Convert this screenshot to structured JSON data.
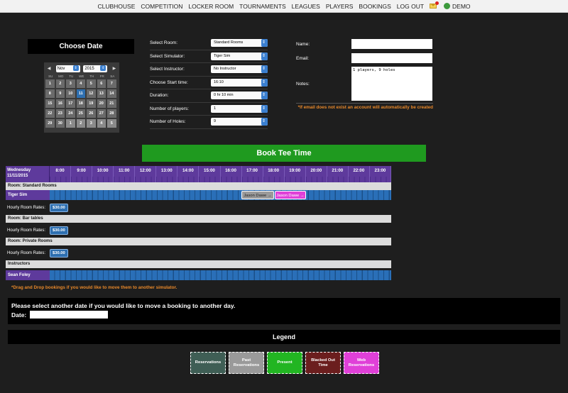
{
  "nav": {
    "items": [
      "CLUBHOUSE",
      "COMPETITION",
      "LOCKER ROOM",
      "TOURNAMENTS",
      "LEAGUES",
      "PLAYERS",
      "BOOKINGS",
      "LOG OUT"
    ],
    "user": "DEMO"
  },
  "date_picker": {
    "title": "Choose Date",
    "month": "Nov",
    "year": "2015",
    "days_of_week": [
      "SU",
      "MO",
      "TU",
      "WE",
      "TH",
      "FR",
      "SA"
    ],
    "days": [
      "1",
      "2",
      "3",
      "4",
      "5",
      "6",
      "7",
      "8",
      "9",
      "10",
      "11",
      "12",
      "13",
      "14",
      "15",
      "16",
      "17",
      "18",
      "19",
      "20",
      "21",
      "22",
      "23",
      "24",
      "25",
      "26",
      "27",
      "28",
      "29",
      "30",
      "1",
      "2",
      "3",
      "4",
      "5"
    ],
    "selected_day": "11"
  },
  "form": {
    "fields": [
      {
        "label": "Select Room:",
        "value": "Standard Rooms"
      },
      {
        "label": "Select Simulator:",
        "value": "Tiger Sim"
      },
      {
        "label": "Select Instructor:",
        "value": "No Instructor"
      },
      {
        "label": "Choose Start time:",
        "value": "16:10"
      },
      {
        "label": "Duration:",
        "value": "0 hr 10 min"
      },
      {
        "label": "Number of players:",
        "value": "1"
      },
      {
        "label": "Number of Holes:",
        "value": "9"
      }
    ],
    "name_label": "Name:",
    "name_value": "",
    "email_label": "Email:",
    "email_value": "",
    "notes_label": "Notes:",
    "notes_value": "1 players, 9 holes",
    "email_note": "*If email does not exist an account will automatically be created"
  },
  "book_button": "Book Tee Time",
  "schedule": {
    "day": "Wednesday",
    "date": "11/11/2015",
    "hours": [
      "8:00",
      "9:00",
      "10:00",
      "11:00",
      "12:00",
      "13:00",
      "14:00",
      "15:00",
      "16:00",
      "17:00",
      "18:00",
      "19:00",
      "20:00",
      "21:00",
      "22:00",
      "23:00"
    ],
    "room_standard": "Room: Standard Rooms",
    "simulator": "Tiger Sim",
    "booking_past": "Jason Dawe →",
    "booking_web": "Jason Dawe →",
    "rates_label": "Hourly Room Rates:",
    "rate_standard": "$30.00",
    "room_bar": "Room: Bar tables",
    "rate_bar": "$30.00",
    "room_private": "Room: Private Rooms",
    "rate_private": "$30.00",
    "instructors": "Instructors",
    "instructor": "Sean Foley",
    "drag_note": "*Drag and Drop bookings if you would like to move them to another simulator."
  },
  "move": {
    "message": "Please select another date if you would like to move a booking to another day.",
    "date_label": "Date:",
    "date_value": ""
  },
  "legend": {
    "title": "Legend",
    "items": [
      {
        "label": "Reservations",
        "color": "#3f5e55"
      },
      {
        "label": "Past Reservations",
        "color": "#9a9a9a"
      },
      {
        "label": "Present",
        "color": "#22b522"
      },
      {
        "label": "Blacked Out Time",
        "color": "#6b1e1e"
      },
      {
        "label": "Web Reservations",
        "color": "#e040d8"
      }
    ]
  }
}
